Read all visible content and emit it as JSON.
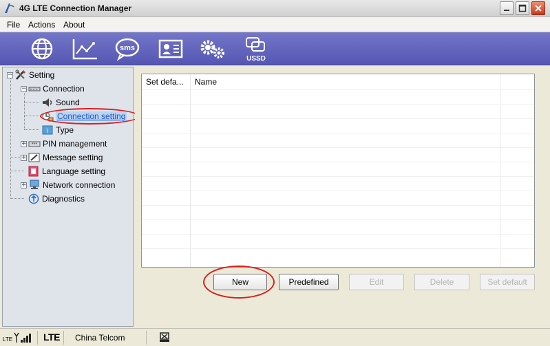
{
  "window": {
    "title": "4G LTE Connection Manager",
    "controls": [
      "minimize-icon",
      "maximize-icon",
      "close-icon"
    ]
  },
  "menu": {
    "file": "File",
    "actions": "Actions",
    "about": "About"
  },
  "toolbar": {
    "items": [
      {
        "icon": "globe-icon"
      },
      {
        "icon": "statistics-chart-icon"
      },
      {
        "icon": "sms-icon",
        "label": "sms"
      },
      {
        "icon": "contacts-card-icon"
      },
      {
        "icon": "settings-gears-icon"
      },
      {
        "icon": "ussd-icon",
        "label": "USSD"
      }
    ]
  },
  "tree": {
    "root": "Setting",
    "connection": "Connection",
    "sound": "Sound",
    "connection_setting": "Connection setting",
    "type": "Type",
    "pin_management": "PIN management",
    "message_setting": "Message setting",
    "language_setting": "Language setting",
    "network_connection": "Network connection",
    "diagnostics": "Diagnostics"
  },
  "table": {
    "columns": [
      "Set defa...",
      "Name"
    ],
    "rows": []
  },
  "buttons": {
    "new": "New",
    "predefined": "Predefined",
    "edit": "Edit",
    "delete": "Delete",
    "set_default": "Set default"
  },
  "status": {
    "signal_label": "LTE",
    "network_type": "LTE",
    "operator": "China Telcom"
  },
  "colors": {
    "toolbar": "#6163c0",
    "annotation": "#d62020",
    "tree_bg": "#dfe3ea"
  }
}
